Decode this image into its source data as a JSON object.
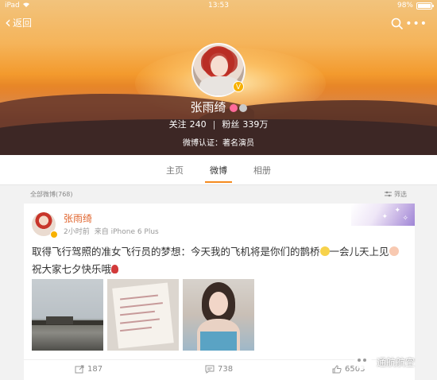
{
  "status_bar": {
    "carrier": "iPad",
    "time": "13:53",
    "battery": "98%",
    "battery_level": 0.98
  },
  "nav": {
    "back_label": "返回",
    "icons": [
      "chevron-left-icon",
      "search-icon",
      "more-icon"
    ]
  },
  "profile": {
    "name": "张雨绮",
    "following_label": "关注",
    "following_count": "240",
    "followers_label": "粉丝",
    "followers_count": "339万",
    "verification": "微博认证：著名演员"
  },
  "tabs": [
    {
      "label": "主页",
      "active": false
    },
    {
      "label": "微博",
      "active": true
    },
    {
      "label": "相册",
      "active": false
    }
  ],
  "feed": {
    "all_count_label": "全部微博(768)",
    "filter_label": "筛选"
  },
  "post": {
    "author": "张雨绮",
    "time": "2小时前",
    "source": "来自 iPhone 6 Plus",
    "text_part1": "取得飞行驾照的准女飞行员的梦想：今天我的飞机将是你们的鹊桥",
    "text_part2": "一会儿天上见",
    "text_part3": " 祝大家七夕快乐哦",
    "emojis": [
      "smile-emoji",
      "hand-emoji",
      "rose-emoji"
    ],
    "photos": [
      "airfield-photo",
      "document-photo",
      "selfie-photo"
    ],
    "actions": {
      "repost_count": "187",
      "comment_count": "738",
      "like_count": "6503"
    }
  },
  "watermark": {
    "text": "通航航空"
  },
  "colors": {
    "accent": "#f58b1f",
    "author_name": "#e0652e",
    "verified_badge": "#f7b100"
  }
}
